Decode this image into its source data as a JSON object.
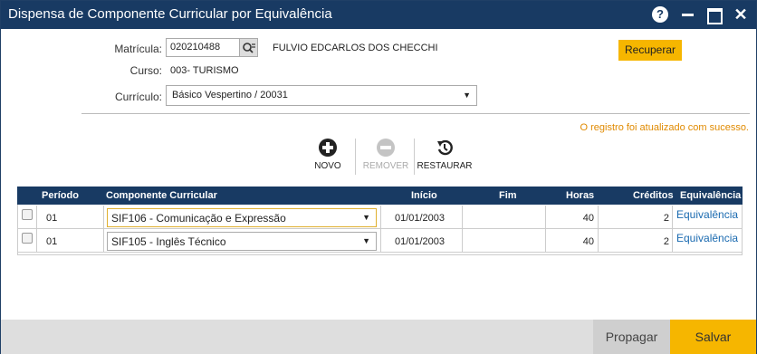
{
  "window": {
    "title": "Dispensa de Componente Curricular por Equivalência",
    "help_label": "?",
    "close_label": "✕"
  },
  "form": {
    "matricula_label": "Matrícula:",
    "matricula_value": "020210488",
    "student_name": "FULVIO EDCARLOS DOS CHECCHI",
    "curso_label": "Curso:",
    "curso_value": "003- TURISMO",
    "curriculo_label": "Currículo:",
    "curriculo_value": "Básico Vespertino / 20031",
    "recuperar_label": "Recuperar"
  },
  "status_message": "O registro foi atualizado com sucesso.",
  "toolbar": {
    "novo_label": "NOVO",
    "remover_label": "REMOVER",
    "restaurar_label": "RESTAURAR"
  },
  "table": {
    "headers": {
      "periodo": "Período",
      "componente": "Componente Curricular",
      "inicio": "Início",
      "fim": "Fim",
      "horas": "Horas",
      "creditos": "Créditos",
      "equivalencia": "Equivalência"
    },
    "rows": [
      {
        "periodo": "01",
        "componente": "SIF106 - Comunicação e Expressão",
        "inicio": "01/01/2003",
        "fim": "",
        "horas": "40",
        "creditos": "2",
        "equivalencia": "Equivalência"
      },
      {
        "periodo": "01",
        "componente": "SIF105 - Inglês Técnico",
        "inicio": "01/01/2003",
        "fim": "",
        "horas": "40",
        "creditos": "2",
        "equivalencia": "Equivalência"
      }
    ]
  },
  "footer": {
    "propagar_label": "Propagar",
    "salvar_label": "Salvar"
  },
  "colors": {
    "titlebar": "#183a63",
    "accent": "#f6b600",
    "success_text": "#e08a00",
    "link": "#1a6ab0"
  }
}
